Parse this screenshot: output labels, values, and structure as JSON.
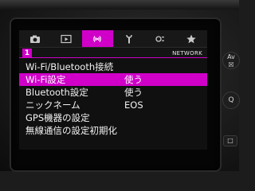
{
  "tabs": [
    {
      "id": "shooting",
      "icon": "camera-icon",
      "active": false
    },
    {
      "id": "playback",
      "icon": "play-icon",
      "active": false
    },
    {
      "id": "wireless",
      "icon": "wireless-icon",
      "active": true
    },
    {
      "id": "setup",
      "icon": "wrench-icon",
      "active": false
    },
    {
      "id": "custom",
      "icon": "custom-function-icon",
      "active": false
    },
    {
      "id": "mymenu",
      "icon": "star-icon",
      "active": false
    }
  ],
  "subbar": {
    "page_number": "1",
    "section_label": "NETWORK"
  },
  "menu": {
    "items": [
      {
        "label": "Wi-Fi/Bluetooth接続",
        "value": ""
      },
      {
        "label": "Wi-Fi設定",
        "value": "使う",
        "selected": true
      },
      {
        "label": "Bluetooth設定",
        "value": "使う"
      },
      {
        "label": "ニックネーム",
        "value": "EOS"
      },
      {
        "label": "GPS機器の設定",
        "value": ""
      },
      {
        "label": "無線通信の設定初期化",
        "value": ""
      }
    ]
  },
  "side_buttons": {
    "av_label": "Av",
    "av_sub": "☒",
    "q_label": "Q",
    "disp_label": "□"
  },
  "colors": {
    "accent": "#d000c8",
    "background": "#101010",
    "text": "#f2f2f2"
  }
}
